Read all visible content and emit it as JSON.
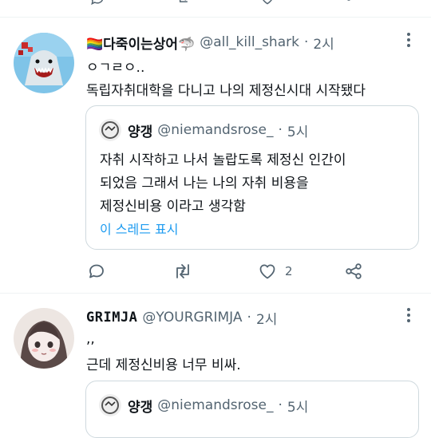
{
  "tweets": [
    {
      "display_name": "🏳️‍🌈다죽이는상어🦈",
      "handle": "@all_kill_shark",
      "dot": "·",
      "time": "2시",
      "lines": [
        "ㅇㄱㄹㅇ..",
        "독립자취대학을 다니고 나의 제정신시대 시작됐다"
      ],
      "quote": {
        "display_name": "양갱",
        "handle": "@niemandsrose_",
        "dot": "·",
        "time": "5시",
        "lines": [
          "자취 시작하고 나서 놀랍도록 제정신 인간이",
          "되었음 그래서 나는 나의 자취 비용을",
          "제정신비용 이라고 생각함"
        ],
        "thread_link": "이 스레드 표시"
      },
      "actions": {
        "reply_icon": "reply-icon",
        "retweet_icon": "retweet-icon",
        "like_icon": "heart-icon",
        "like_count": "2",
        "share_icon": "share-icon"
      }
    },
    {
      "display_name": "GRIMJA",
      "handle": "@YOURGRIMJA",
      "dot": "·",
      "time": "2시",
      "lines": [
        ",,",
        "근데 제정신비용 너무 비싸."
      ],
      "quote": {
        "display_name": "양갱",
        "handle": "@niemandsrose_",
        "dot": "·",
        "time": "5시"
      }
    }
  ],
  "colors": {
    "text": "#0f1419",
    "secondary": "#536471",
    "link": "#1d9bf0",
    "border": "#cfd9de",
    "divider": "#eff3f4"
  }
}
